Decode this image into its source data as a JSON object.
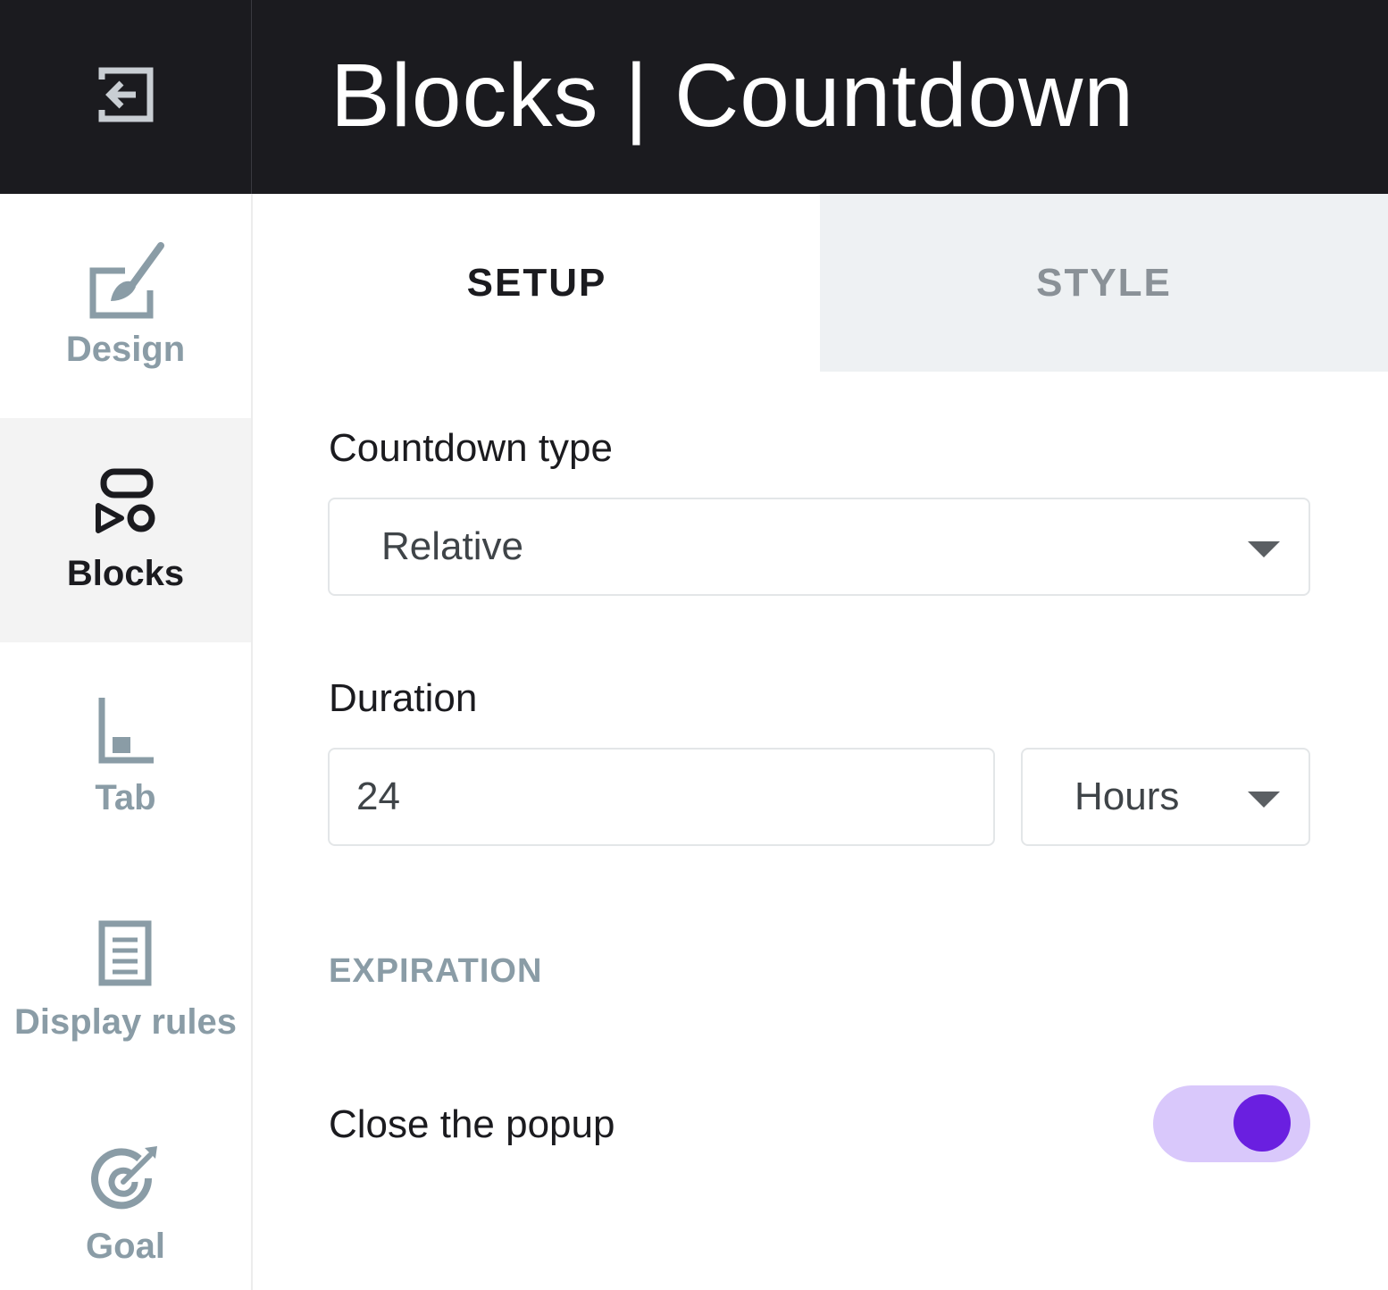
{
  "header": {
    "title": "Blocks | Countdown",
    "back_icon": "exit-arrow-icon"
  },
  "sidebar": {
    "items": [
      {
        "label": "Design",
        "icon": "paintbrush-icon",
        "active": false
      },
      {
        "label": "Blocks",
        "icon": "blocks-shapes-icon",
        "active": true
      },
      {
        "label": "Tab",
        "icon": "tab-icon",
        "active": false
      },
      {
        "label": "Display rules",
        "icon": "document-list-icon",
        "active": false
      },
      {
        "label": "Goal",
        "icon": "target-icon",
        "active": false
      }
    ]
  },
  "tabs": [
    {
      "label": "SETUP",
      "active": true
    },
    {
      "label": "STYLE",
      "active": false
    }
  ],
  "form": {
    "countdown_type": {
      "label": "Countdown type",
      "value": "Relative"
    },
    "duration": {
      "label": "Duration",
      "value": "24",
      "unit": "Hours"
    },
    "expiration": {
      "heading": "EXPIRATION",
      "close_popup": {
        "label": "Close the popup",
        "on": true
      }
    }
  },
  "colors": {
    "header_bg": "#1b1b1f",
    "accent": "#6a1fe0",
    "toggle_track": "#d9c8fb",
    "muted": "#8a9ca6"
  }
}
